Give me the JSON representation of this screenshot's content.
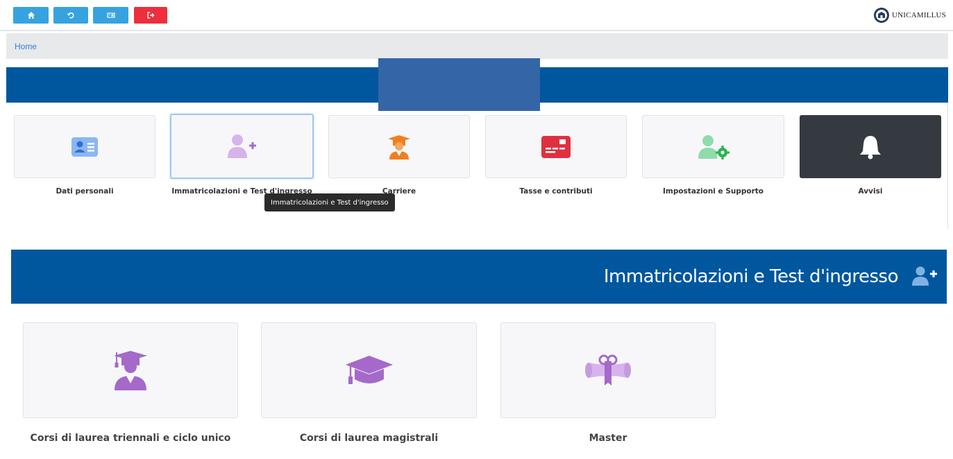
{
  "toolbar": {
    "buttons": [
      {
        "icon": "home-icon",
        "color": "#36a3e0"
      },
      {
        "icon": "history-icon",
        "color": "#36a3e0"
      },
      {
        "icon": "id-card-icon",
        "color": "#36a3e0"
      },
      {
        "icon": "logout-icon",
        "color": "#ee2e3c"
      }
    ],
    "brand": "UNICAMILLUS"
  },
  "breadcrumb": {
    "home": "Home"
  },
  "menu": {
    "cards": [
      {
        "label": "Dati personali",
        "icon": "id-card-icon",
        "color": "#4f8fe6"
      },
      {
        "label": "Immatricolazioni e Test d'ingresso",
        "icon": "user-plus-icon",
        "color": "#b77ed6",
        "selected": true
      },
      {
        "label": "Carriere",
        "icon": "graduate-icon",
        "color": "#f07f21"
      },
      {
        "label": "Tasse e contributi",
        "icon": "credit-card-icon",
        "color": "#e0303f"
      },
      {
        "label": "Impostazioni e Supporto",
        "icon": "user-gear-icon",
        "color": "#48c774"
      },
      {
        "label": "Avvisi",
        "icon": "bell-icon",
        "color": "#ffffff"
      }
    ],
    "tooltip": "Immatricolazioni e Test d'ingresso"
  },
  "section": {
    "title": "Immatricolazioni e Test d'ingresso",
    "icon": "user-plus-icon",
    "cards": [
      {
        "label": "Corsi di laurea triennali e ciclo unico",
        "icon": "graduate-icon"
      },
      {
        "label": "Corsi di laurea magistrali",
        "icon": "graduation-cap-icon"
      },
      {
        "label": "Master",
        "icon": "diploma-icon"
      }
    ]
  },
  "colors": {
    "primary": "#00579e",
    "accent_purple": "#a569c9"
  }
}
